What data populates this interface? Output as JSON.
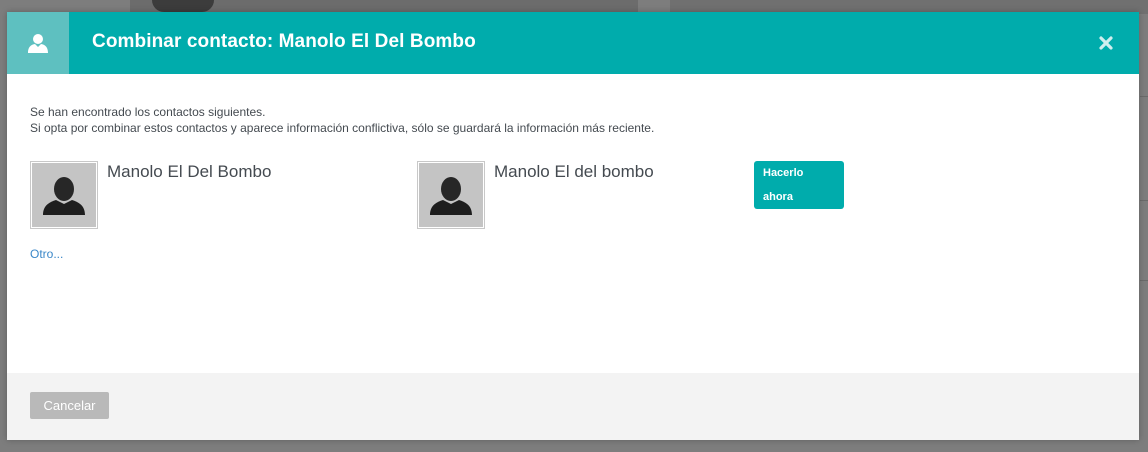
{
  "dialog": {
    "title": "Combinar contacto: Manolo El Del Bombo",
    "header_icon": "user-icon",
    "close_icon": "close-icon"
  },
  "body": {
    "intro_line1": "Se han encontrado los contactos siguientes.",
    "intro_line2": "Si opta por combinar estos contactos y aparece información conflictiva, sólo se guardará la información más reciente.",
    "contacts": [
      {
        "name": "Manolo El Del Bombo",
        "avatar": "default-avatar-icon"
      },
      {
        "name": "Manolo El del bombo",
        "avatar": "default-avatar-icon"
      }
    ],
    "action_label_line1": "Hacerlo",
    "action_label_line2": "ahora",
    "other_link": "Otro..."
  },
  "footer": {
    "cancel_label": "Cancelar"
  },
  "colors": {
    "accent": "#00acac",
    "accent_light": "#5ec0c0",
    "link": "#3a87c8",
    "text": "#444a50",
    "footer_bg": "#f3f3f3",
    "cancel_bg": "#b9b9b9"
  }
}
